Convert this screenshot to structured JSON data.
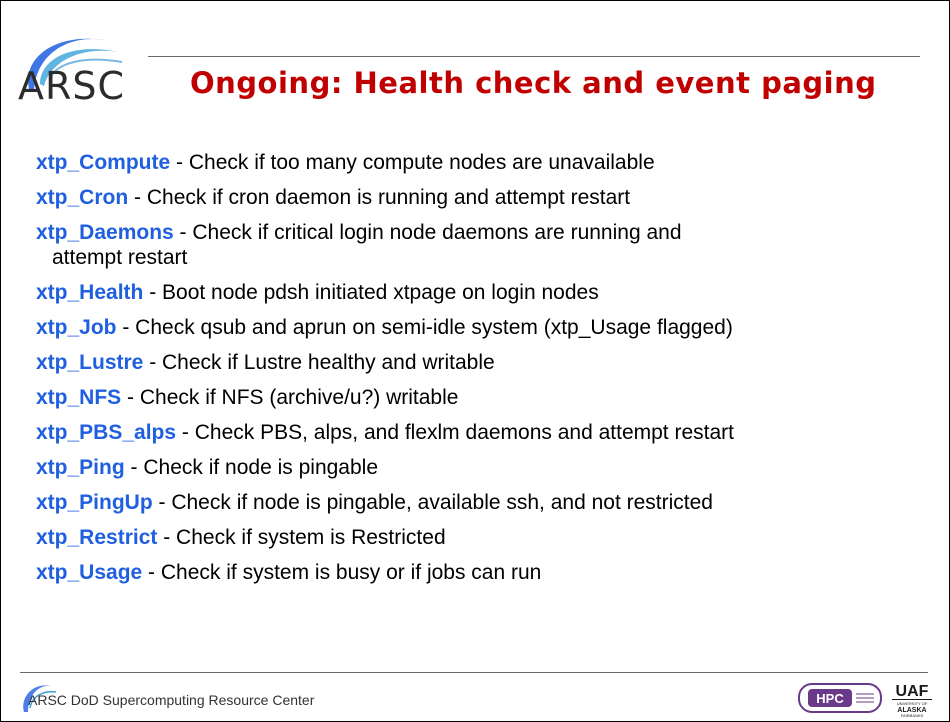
{
  "title": "Ongoing: Health check and event paging",
  "logo_text": "ARSC",
  "footer": {
    "text": "ARSC DoD Supercomputing Resource Center",
    "hpc_logo": "HPC",
    "uaf_logo": "UAF UNIVERSITY OF ALASKA FAIRBANKS"
  },
  "items": [
    {
      "name": "xtp_Compute",
      "desc": " - Check if too many compute nodes are unavailable"
    },
    {
      "name": "xtp_Cron",
      "desc": " - Check if cron daemon is running and attempt restart"
    },
    {
      "name": "xtp_Daemons",
      "desc": " - Check if critical login node daemons are running and",
      "cont": "attempt restart"
    },
    {
      "name": "xtp_Health",
      "desc": " - Boot node pdsh initiated xtpage on login nodes"
    },
    {
      "name": "xtp_Job",
      "desc": " - Check qsub and aprun on semi-idle system (xtp_Usage flagged)"
    },
    {
      "name": "xtp_Lustre",
      "desc": " - Check if Lustre healthy and writable"
    },
    {
      "name": "xtp_NFS",
      "desc": " - Check if NFS (archive/u?) writable"
    },
    {
      "name": "xtp_PBS_alps",
      "desc": " - Check PBS, alps, and flexlm daemons and attempt restart"
    },
    {
      "name": "xtp_Ping",
      "desc": " - Check if node is pingable"
    },
    {
      "name": "xtp_PingUp",
      "desc": " - Check if node is pingable, available ssh, and not restricted"
    },
    {
      "name": "xtp_Restrict",
      "desc": " - Check if system is Restricted"
    },
    {
      "name": "xtp_Usage",
      "desc": " - Check if system is busy or if jobs can run"
    }
  ]
}
